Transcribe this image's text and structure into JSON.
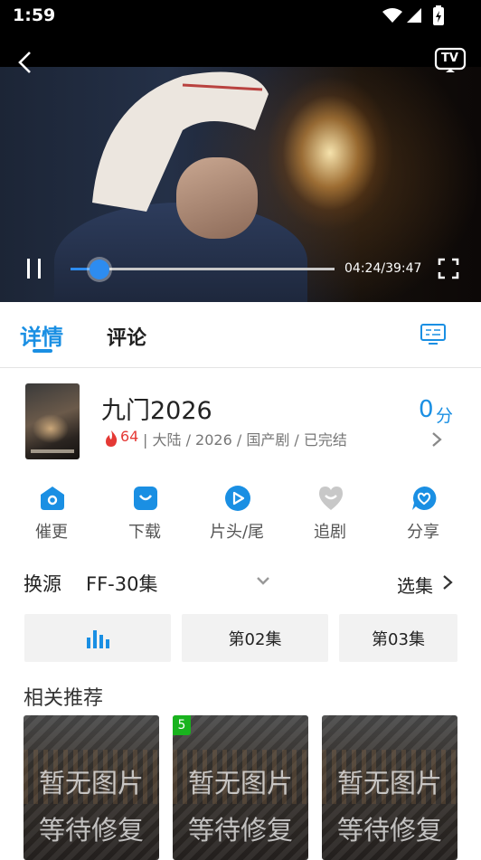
{
  "status_bar": {
    "time": "1:59"
  },
  "player": {
    "time": "04:24/39:47",
    "progress": 0.11,
    "tv_label": "TV"
  },
  "tabs": [
    {
      "label": "详情",
      "active": true
    },
    {
      "label": "评论",
      "active": false
    }
  ],
  "show": {
    "title": "九门2026",
    "rating_value": "0",
    "rating_unit": "分",
    "hot_count": "64",
    "meta": "| 大陆 / 2026 / 国产剧 / 已完结"
  },
  "actions": [
    {
      "label": "催更",
      "icon": "remind-icon"
    },
    {
      "label": "下载",
      "icon": "download-icon"
    },
    {
      "label": "片头/尾",
      "icon": "play-icon"
    },
    {
      "label": "追剧",
      "icon": "follow-icon"
    },
    {
      "label": "分享",
      "icon": "share-icon"
    }
  ],
  "source": {
    "label": "换源",
    "value": "FF-30集",
    "select_label": "选集"
  },
  "episodes": [
    {
      "label": "",
      "current": true
    },
    {
      "label": "第02集",
      "current": false
    },
    {
      "label": "第03集",
      "current": false
    }
  ],
  "recommendations": {
    "title": "相关推荐",
    "items": [
      {
        "placeholder_line1": "暂无图片",
        "placeholder_line2": "等待修复",
        "badge": ""
      },
      {
        "placeholder_line1": "暂无图片",
        "placeholder_line2": "等待修复",
        "badge": "5"
      },
      {
        "placeholder_line1": "暂无图片",
        "placeholder_line2": "等待修复",
        "badge": ""
      }
    ]
  },
  "colors": {
    "accent": "#1a8fe3",
    "hot": "#e53935",
    "badge": "#19b31e"
  }
}
